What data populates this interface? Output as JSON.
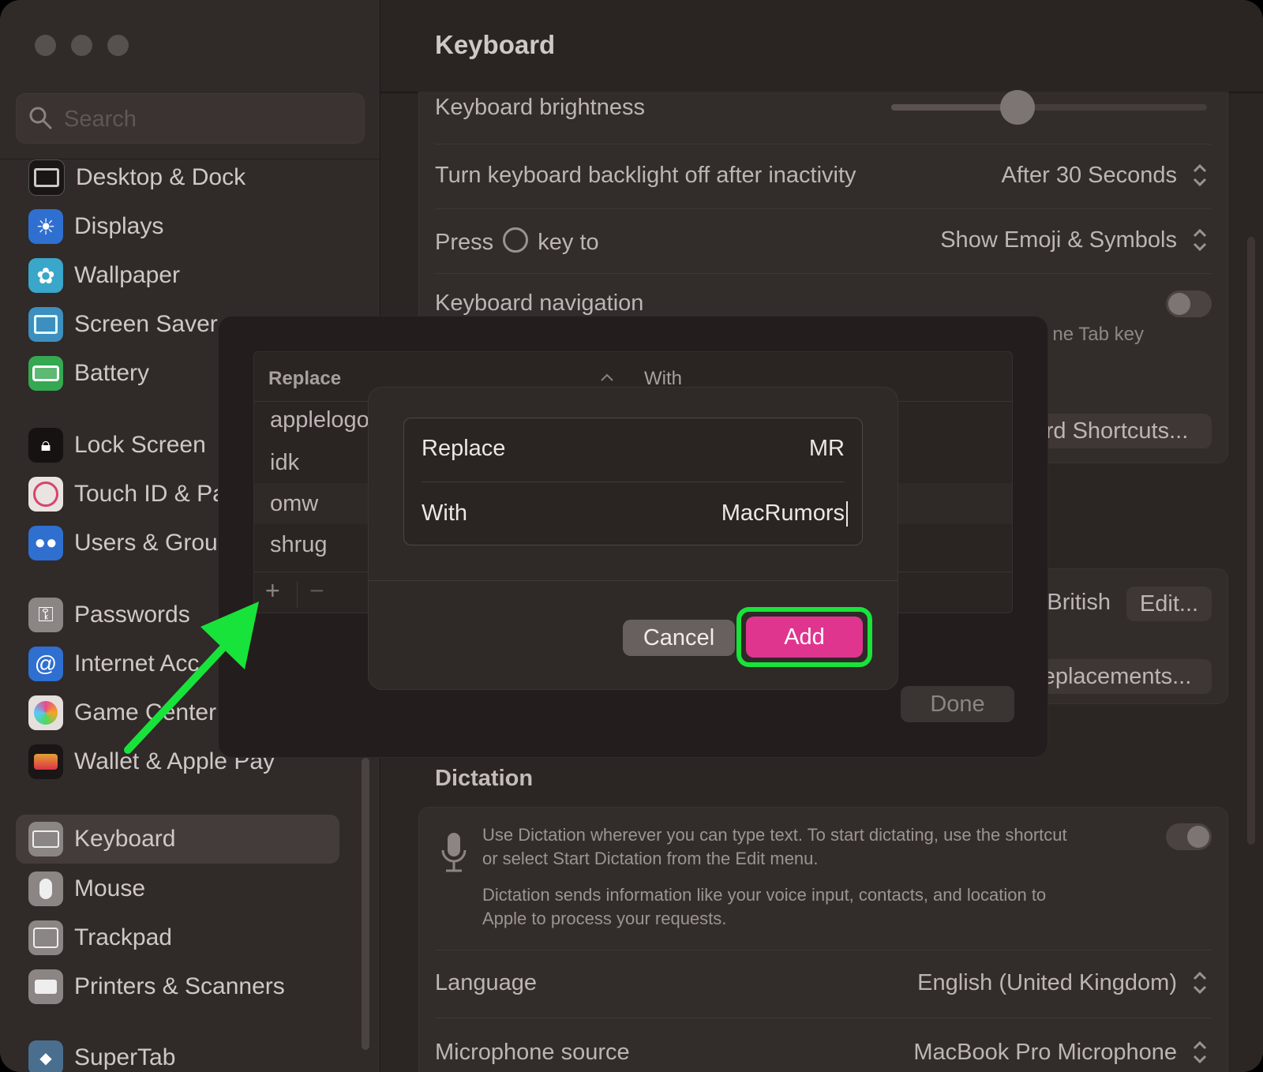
{
  "window": {
    "title": "Keyboard"
  },
  "search": {
    "placeholder": "Search"
  },
  "sidebar": {
    "items": [
      {
        "label": "Desktop & Dock",
        "icon": "desktop-dock-icon"
      },
      {
        "label": "Displays",
        "icon": "displays-icon"
      },
      {
        "label": "Wallpaper",
        "icon": "wallpaper-icon"
      },
      {
        "label": "Screen Saver",
        "icon": "screen-saver-icon"
      },
      {
        "label": "Battery",
        "icon": "battery-icon"
      },
      {
        "label": "Lock Screen",
        "icon": "lock-screen-icon"
      },
      {
        "label": "Touch ID & Pa",
        "icon": "touch-id-icon"
      },
      {
        "label": "Users & Grou",
        "icon": "users-groups-icon"
      },
      {
        "label": "Passwords",
        "icon": "passwords-icon"
      },
      {
        "label": "Internet Acc",
        "icon": "internet-accounts-icon"
      },
      {
        "label": "Game Center",
        "icon": "game-center-icon"
      },
      {
        "label": "Wallet & Apple Pay",
        "icon": "wallet-icon"
      },
      {
        "label": "Keyboard",
        "icon": "keyboard-icon",
        "selected": true
      },
      {
        "label": "Mouse",
        "icon": "mouse-icon"
      },
      {
        "label": "Trackpad",
        "icon": "trackpad-icon"
      },
      {
        "label": "Printers & Scanners",
        "icon": "printers-icon"
      },
      {
        "label": "SuperTab",
        "icon": "supertab-icon"
      }
    ]
  },
  "keyboard": {
    "brightness_label": "Keyboard brightness",
    "brightness_level": 0.4,
    "backlight_label": "Turn keyboard backlight off after inactivity",
    "backlight_value": "After 30 Seconds",
    "globe_prefix": "Press",
    "globe_suffix": "key to",
    "globe_value": "Show Emoji & Symbols",
    "navigation_label": "Keyboard navigation",
    "navigation_desc_fragment": "ne Tab key",
    "shortcuts_button_fragment": "rd Shortcuts...",
    "input_source_fragment": "British",
    "edit_button": "Edit...",
    "replacements_button_fragment": "eplacements..."
  },
  "dictation": {
    "title": "Dictation",
    "desc1": "Use Dictation wherever you can type text. To start dictating, use the shortcut",
    "desc2": "or select Start Dictation from the Edit menu.",
    "desc3": "Dictation sends information like your voice input, contacts, and location to",
    "desc4": "Apple to process your requests.",
    "language_label": "Language",
    "language_value": "English (United Kingdom)",
    "mic_label": "Microphone source",
    "mic_value": "MacBook Pro Microphone"
  },
  "replacements": {
    "col_replace": "Replace",
    "col_with": "With",
    "rows": [
      "applelogo",
      "idk",
      "omw",
      "shrug"
    ],
    "add_symbol": "+",
    "remove_symbol": "−",
    "done": "Done"
  },
  "add_dialog": {
    "replace_label": "Replace",
    "replace_value": "MR",
    "with_label": "With",
    "with_value": "MacRumors",
    "cancel": "Cancel",
    "add": "Add"
  },
  "colors": {
    "accent_add": "#e0358f",
    "highlight": "#18e33a"
  }
}
